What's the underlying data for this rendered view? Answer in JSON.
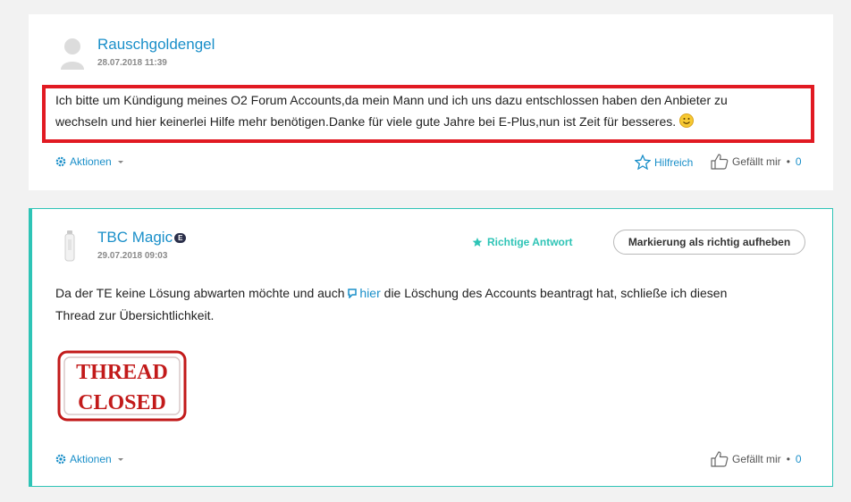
{
  "post1": {
    "author": "Rauschgoldengel",
    "date": "28.07.2018 11:39",
    "body_line1": "Ich bitte um Kündigung meines O2 Forum Accounts,da mein Mann und ich uns dazu entschlossen haben den Anbieter zu",
    "body_line2": "wechseln und hier keinerlei Hilfe mehr benötigen.Danke für viele gute Jahre bei E-Plus,nun ist Zeit für besseres.",
    "actions_label": "Aktionen",
    "helpful_label": "Hilfreich",
    "likes_label": "Gefällt mir",
    "likes_count": "0"
  },
  "post2": {
    "author": "TBC Magic",
    "role_badge": "E",
    "date": "29.07.2018 09:03",
    "accepted_label": "Richtige Antwort",
    "unmark_button_label": "Markierung als richtig aufheben",
    "body_line1_before": "Da der TE keine Lösung abwarten möchte und auch",
    "body_link": "hier",
    "body_line1_after": "die Löschung des Accounts beantragt hat, schließe ich diesen",
    "body_line2": "Thread zur Übersichtlichkeit.",
    "stamp_line1": "THREAD",
    "stamp_line2": "CLOSED",
    "actions_label": "Aktionen",
    "likes_label": "Gefällt mir",
    "likes_count": "0"
  },
  "colors": {
    "link": "#1a8fc9",
    "accent_teal": "#2ec4b6",
    "highlight_red": "#e11a22",
    "stamp_red": "#c21a1a"
  },
  "icons": [
    "user-avatar-icon",
    "gear-icon",
    "caret-down-icon",
    "star-outline-icon",
    "thumbs-up-icon",
    "star-solid-icon",
    "smiley-icon",
    "external-link-icon"
  ]
}
